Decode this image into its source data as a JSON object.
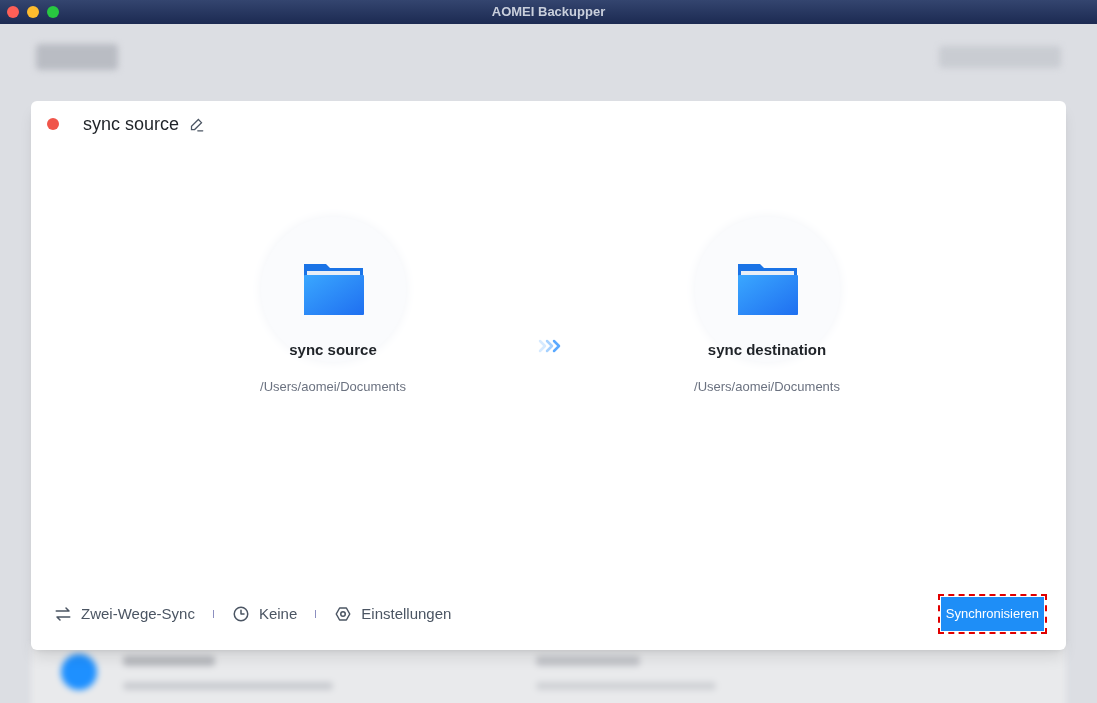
{
  "window": {
    "title": "AOMEI Backupper"
  },
  "task": {
    "name": "sync source",
    "color": "#f0554a"
  },
  "endpoints": [
    {
      "name": "sync source",
      "path": "/Users/aomei/Documents"
    },
    {
      "name": "sync destination",
      "path": "/Users/aomei/Documents"
    }
  ],
  "options": [
    {
      "kind": "mode",
      "label": "Zwei-Wege-Sync"
    },
    {
      "kind": "schedule",
      "label": "Keine"
    },
    {
      "kind": "settings",
      "label": "Einstellungen"
    }
  ],
  "primary_button": {
    "label": "Synchronisieren",
    "focused": true
  }
}
